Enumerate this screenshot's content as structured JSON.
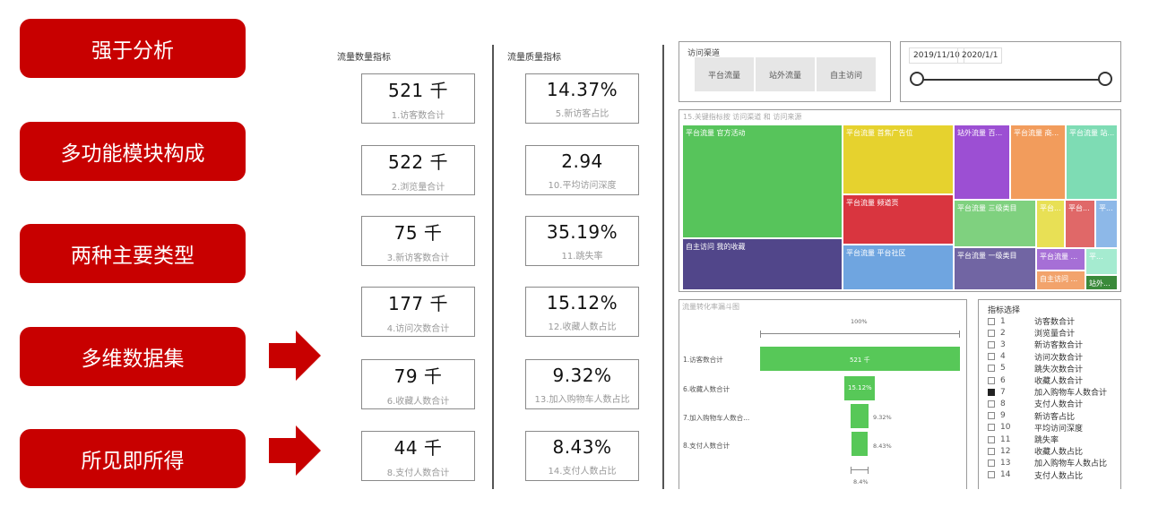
{
  "features": [
    "强于分析",
    "多功能模块构成",
    "两种主要类型",
    "多维数据集",
    "所见即所得"
  ],
  "quantity_section": {
    "title": "流量数量指标",
    "kpis": [
      {
        "value": "521 千",
        "label": "1.访客数合计"
      },
      {
        "value": "522 千",
        "label": "2.浏览量合计"
      },
      {
        "value": "75 千",
        "label": "3.新访客数合计"
      },
      {
        "value": "177 千",
        "label": "4.访问次数合计"
      },
      {
        "value": "79 千",
        "label": "6.收藏人数合计"
      },
      {
        "value": "44 千",
        "label": "8.支付人数合计"
      }
    ]
  },
  "quality_section": {
    "title": "流量质量指标",
    "kpis": [
      {
        "value": "14.37%",
        "label": "5.新访客占比"
      },
      {
        "value": "2.94",
        "label": "10.平均访问深度"
      },
      {
        "value": "35.19%",
        "label": "11.跳失率"
      },
      {
        "value": "15.12%",
        "label": "12.收藏人数占比"
      },
      {
        "value": "9.32%",
        "label": "13.加入购物车人数占比"
      },
      {
        "value": "8.43%",
        "label": "14.支付人数占比"
      }
    ]
  },
  "channel_panel": {
    "title": "访问渠道",
    "buttons": [
      "平台流量",
      "站外流量",
      "自主访问"
    ]
  },
  "date_panel": {
    "start": "2019/11/10",
    "end": "2020/1/1"
  },
  "treemap": {
    "title": "15.关键指标按 访问渠道 和 访问来源",
    "tiles": [
      {
        "label": "平台流量 官方活动",
        "color": "#57c45b"
      },
      {
        "label": "平台流量 首焦广告位",
        "color": "#e6d22e"
      },
      {
        "label": "站外流量 百...",
        "color": "#9c4fd3"
      },
      {
        "label": "平台流量 商...",
        "color": "#f29c5c"
      },
      {
        "label": "平台流量 站...",
        "color": "#7edcb4"
      },
      {
        "label": "平台流量 频道页",
        "color": "#d9353f"
      },
      {
        "label": "自主访问 我的收藏",
        "color": "#51468a"
      },
      {
        "label": "平台流量 平台社区",
        "color": "#6fa5e0"
      },
      {
        "label": "平台流量 三级类目",
        "color": "#7fd17f"
      },
      {
        "label": "平台...",
        "color": "#e8e055"
      },
      {
        "label": "平台...",
        "color": "#e06868"
      },
      {
        "label": "平...",
        "color": "#8db8e8"
      },
      {
        "label": "平台流量 一级类目",
        "color": "#7165a3"
      },
      {
        "label": "平台流量 ...",
        "color": "#a66fd6"
      },
      {
        "label": "平...",
        "color": "#a5ebd0"
      },
      {
        "label": "自主访问 ...",
        "color": "#f2a36c"
      },
      {
        "label": "站外...",
        "color": "#3a8a3a"
      }
    ]
  },
  "funnel": {
    "title": "流量转化率漏斗图",
    "top_pct": "100%",
    "bottom_pct": "8.4%",
    "stages": [
      {
        "label": "1.访客数合计",
        "value": 100,
        "bar_label": "521 千",
        "pct": ""
      },
      {
        "label": "6.收藏人数合计",
        "value": 15.12,
        "bar_label": "15.12%",
        "pct": ""
      },
      {
        "label": "7.加入购物车人数合...",
        "value": 9.32,
        "bar_label": "",
        "pct": "9.32%"
      },
      {
        "label": "8.支付人数合计",
        "value": 8.43,
        "bar_label": "",
        "pct": "8.43%"
      }
    ]
  },
  "metric_selector": {
    "title": "指标选择",
    "items": [
      {
        "num": "1",
        "label": "访客数合计",
        "checked": false
      },
      {
        "num": "2",
        "label": "浏览量合计",
        "checked": false
      },
      {
        "num": "3",
        "label": "新访客数合计",
        "checked": false
      },
      {
        "num": "4",
        "label": "访问次数合计",
        "checked": false
      },
      {
        "num": "5",
        "label": "跳失次数合计",
        "checked": false
      },
      {
        "num": "6",
        "label": "收藏人数合计",
        "checked": false
      },
      {
        "num": "7",
        "label": "加入购物车人数合计",
        "checked": true
      },
      {
        "num": "8",
        "label": "支付人数合计",
        "checked": false
      },
      {
        "num": "9",
        "label": "新访客占比",
        "checked": false
      },
      {
        "num": "10",
        "label": "平均访问深度",
        "checked": false
      },
      {
        "num": "11",
        "label": "跳失率",
        "checked": false
      },
      {
        "num": "12",
        "label": "收藏人数占比",
        "checked": false
      },
      {
        "num": "13",
        "label": "加入购物车人数占比",
        "checked": false
      },
      {
        "num": "14",
        "label": "支付人数占比",
        "checked": false
      }
    ]
  },
  "colors": {
    "brand_red": "#c80000",
    "funnel_green": "#57c858"
  }
}
